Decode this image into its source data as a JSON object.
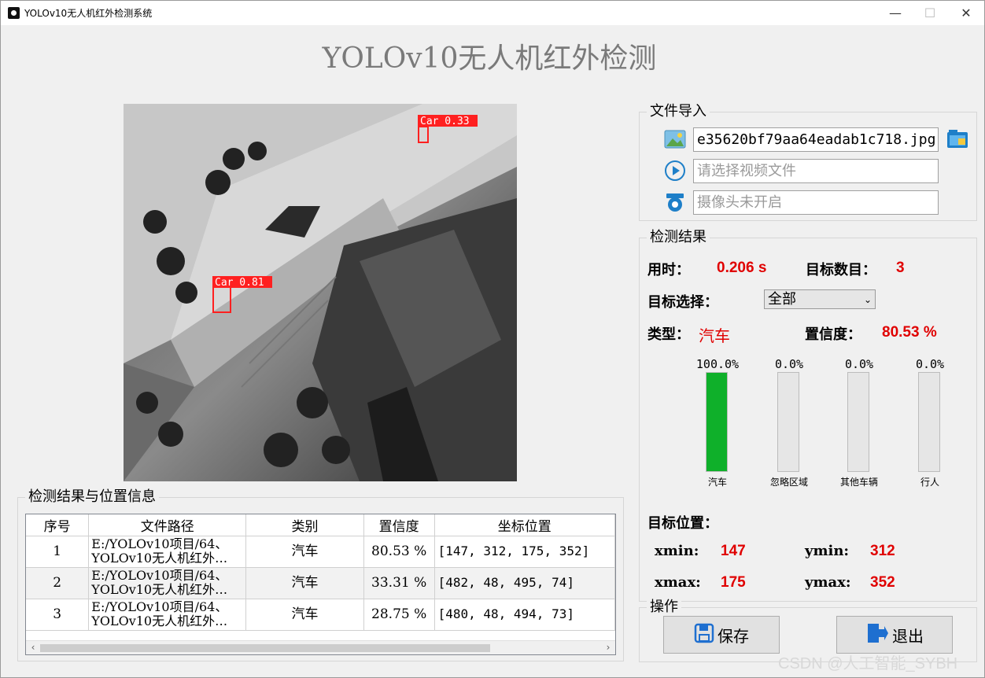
{
  "window": {
    "title": "YOLOv10无人机红外检测系统",
    "minimize": "—",
    "maximize": "☐",
    "close": "✕"
  },
  "main_title": "YOLOv10无人机红外检测",
  "detections_overlay": [
    {
      "label": "Car 0.33"
    },
    {
      "label": "Car 0.81"
    }
  ],
  "file_import": {
    "legend": "文件导入",
    "image_value": "e35620bf79aa64eadab1c718.jpg",
    "video_placeholder": "请选择视频文件",
    "camera_placeholder": "摄像头未开启"
  },
  "result": {
    "legend": "检测结果",
    "time_label": "用时：",
    "time_value": "0.206 s",
    "count_label": "目标数目：",
    "count_value": "3",
    "select_label": "目标选择：",
    "select_value": "全部",
    "type_label": "类型：",
    "type_value": "汽车",
    "conf_label": "置信度：",
    "conf_value": "80.53 %",
    "bars": [
      {
        "pct": "100.0%",
        "name": "汽车",
        "fill": 1.0
      },
      {
        "pct": "0.0%",
        "name": "忽略区域",
        "fill": 0.0
      },
      {
        "pct": "0.0%",
        "name": "其他车辆",
        "fill": 0.0
      },
      {
        "pct": "0.0%",
        "name": "行人",
        "fill": 0.0
      }
    ],
    "pos_label": "目标位置：",
    "xmin_label": "xmin:",
    "xmin": "147",
    "ymin_label": "ymin:",
    "ymin": "312",
    "xmax_label": "xmax:",
    "xmax": "175",
    "ymax_label": "ymax:",
    "ymax": "352"
  },
  "ops": {
    "legend": "操作",
    "save": "保存",
    "exit": "退出"
  },
  "table": {
    "legend": "检测结果与位置信息",
    "headers": [
      "序号",
      "文件路径",
      "类别",
      "置信度",
      "坐标位置"
    ],
    "rows": [
      {
        "idx": "1",
        "path1": "E:/YOLOv10项目/64、",
        "path2": "YOLOv10无人机红外…",
        "cls": "汽车",
        "conf": "80.53 %",
        "coord": "[147, 312, 175, 352]"
      },
      {
        "idx": "2",
        "path1": "E:/YOLOv10项目/64、",
        "path2": "YOLOv10无人机红外…",
        "cls": "汽车",
        "conf": "33.31 %",
        "coord": "[482, 48, 495, 74]"
      },
      {
        "idx": "3",
        "path1": "E:/YOLOv10项目/64、",
        "path2": "YOLOv10无人机红外…",
        "cls": "汽车",
        "conf": "28.75 %",
        "coord": "[480, 48, 494, 73]"
      }
    ]
  },
  "watermark": "CSDN @人工智能_SYBH",
  "colors": {
    "accent_red": "#e00000",
    "bar_green": "#0fb02a",
    "box_red": "#ff2020"
  }
}
